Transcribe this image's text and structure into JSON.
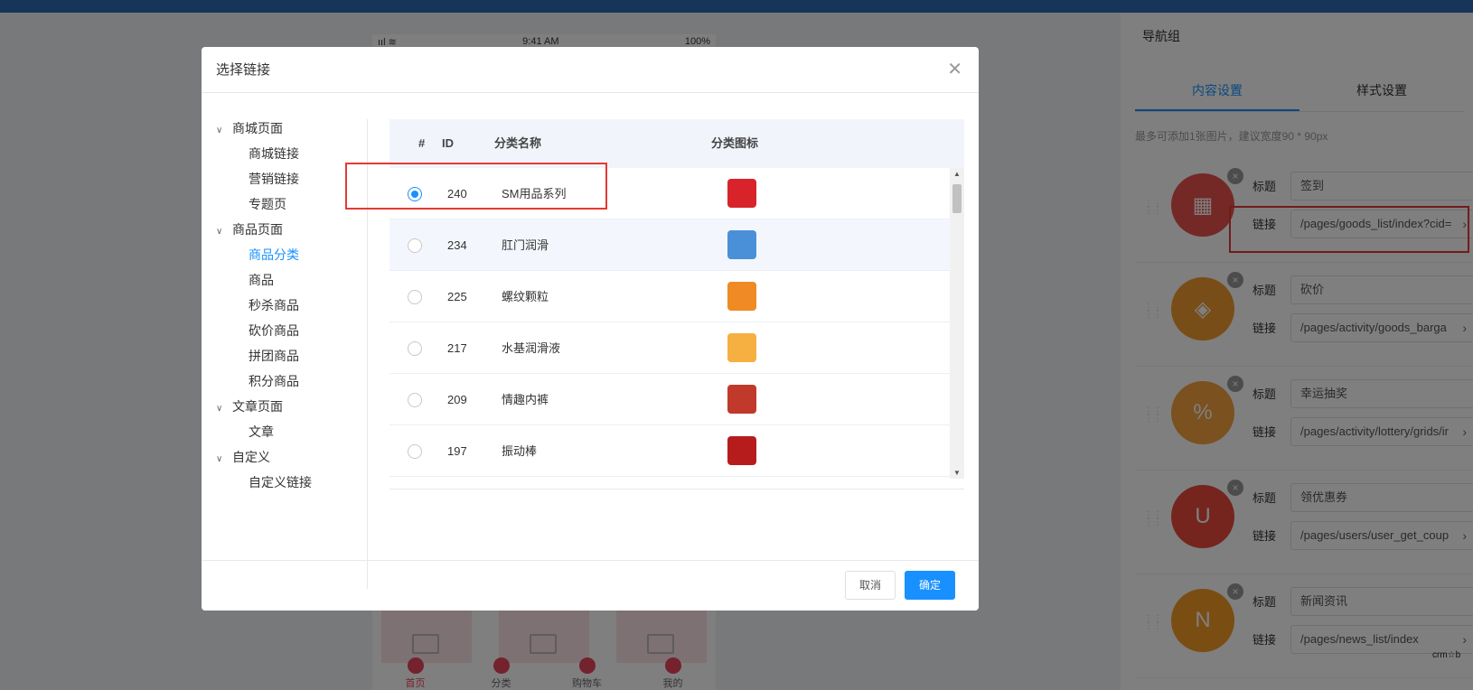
{
  "preview": {
    "signal": "ııl ≋",
    "time": "9:41 AM",
    "battery": "100%",
    "tabs": [
      "首页",
      "分类",
      "购物车",
      "我的"
    ]
  },
  "panel": {
    "title": "导航组",
    "tabs": [
      "内容设置",
      "样式设置"
    ],
    "hint": "最多可添加1张图片，建议宽度90 * 90px",
    "title_label": "标题",
    "link_label": "链接",
    "items": [
      {
        "title": "签到",
        "link": "/pages/goods_list/index?cid=",
        "color": "#e9534f",
        "icon": "calendar-icon"
      },
      {
        "title": "砍价",
        "link": "/pages/activity/goods_barga",
        "color": "#f39a2f",
        "icon": "tag-icon"
      },
      {
        "title": "幸运抽奖",
        "link": "/pages/activity/lottery/grids/ir",
        "color": "#f5a23e",
        "icon": "discount-bag-icon"
      },
      {
        "title": "领优惠券",
        "link": "/pages/users/user_get_coup",
        "color": "#ea4a3d",
        "icon": "gift-bag-icon"
      },
      {
        "title": "新闻资讯",
        "link": "/pages/news_list/index",
        "color": "#f59a27",
        "icon": "news-icon"
      }
    ],
    "watermark": "crm☆b"
  },
  "modal": {
    "title": "选择链接",
    "tree": [
      {
        "label": "商城页面",
        "level": 0,
        "active": false
      },
      {
        "label": "商城链接",
        "level": 1,
        "active": false
      },
      {
        "label": "营销链接",
        "level": 1,
        "active": false
      },
      {
        "label": "专题页",
        "level": 1,
        "active": false
      },
      {
        "label": "商品页面",
        "level": 0,
        "active": false
      },
      {
        "label": "商品分类",
        "level": 1,
        "active": true
      },
      {
        "label": "商品",
        "level": 1,
        "active": false
      },
      {
        "label": "秒杀商品",
        "level": 1,
        "active": false
      },
      {
        "label": "砍价商品",
        "level": 1,
        "active": false
      },
      {
        "label": "拼团商品",
        "level": 1,
        "active": false
      },
      {
        "label": "积分商品",
        "level": 1,
        "active": false
      },
      {
        "label": "文章页面",
        "level": 0,
        "active": false
      },
      {
        "label": "文章",
        "level": 1,
        "active": false
      },
      {
        "label": "自定义",
        "level": 0,
        "active": false
      },
      {
        "label": "自定义链接",
        "level": 1,
        "active": false
      }
    ],
    "columns": {
      "select": "#",
      "id": "ID",
      "name": "分类名称",
      "icon": "分类图标"
    },
    "rows": [
      {
        "id": "240",
        "name": "SM用品系列",
        "selected": true,
        "thumb": "#d8232a"
      },
      {
        "id": "234",
        "name": "肛门润滑",
        "selected": false,
        "thumb": "#4a90d9"
      },
      {
        "id": "225",
        "name": "螺纹颗粒",
        "selected": false,
        "thumb": "#f08a24"
      },
      {
        "id": "217",
        "name": "水基润滑液",
        "selected": false,
        "thumb": "#f5b041"
      },
      {
        "id": "209",
        "name": "情趣内裤",
        "selected": false,
        "thumb": "#c0392b"
      },
      {
        "id": "197",
        "name": "振动棒",
        "selected": false,
        "thumb": "#b71c1c"
      }
    ],
    "cancel": "取消",
    "confirm": "确定"
  }
}
